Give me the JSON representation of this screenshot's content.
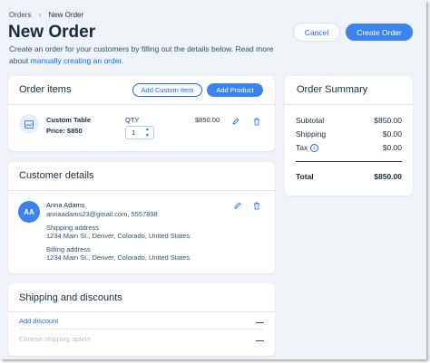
{
  "breadcrumb": {
    "parent": "Orders",
    "current": "New Order"
  },
  "page": {
    "title": "New Order",
    "subtitle_text": "Create an order for your customers by filling out the details below. Read more about",
    "subtitle_link": "manually creating an order",
    "subtitle_end": "."
  },
  "header_actions": {
    "cancel": "Cancel",
    "create": "Create Order"
  },
  "order_items": {
    "title": "Order items",
    "add_custom_item": "Add Custom Item",
    "add_product": "Add Product",
    "item": {
      "name": "Custom Table",
      "price_label": "Price: $850",
      "qty_label": "QTY",
      "qty_value": "1",
      "total": "$850.00"
    }
  },
  "customer": {
    "title": "Customer details",
    "initials": "AA",
    "name": "Anna Adams",
    "contact": "annaadams23@gmail.com, 5557898",
    "shipping_label": "Shipping address",
    "shipping_value": "1234 Main St., Denver, Colorado, United States",
    "billing_label": "Billing address",
    "billing_value": "1234 Main St., Denver, Colorado, United States"
  },
  "shipping": {
    "title": "Shipping and discounts",
    "add_discount": "Add discount",
    "shipping_option": "Choose shipping option"
  },
  "summary": {
    "title": "Order Summary",
    "subtotal_label": "Subtotal",
    "subtotal_value": "$850.00",
    "shipping_label": "Shipping",
    "shipping_value": "$0.00",
    "tax_label": "Tax",
    "tax_value": "$0.00",
    "total_label": "Total",
    "total_value": "$850.00"
  },
  "colors": {
    "accent": "#116dff",
    "background": "#eff3f8",
    "text": "#162d3d",
    "avatar": "#3b84f0"
  },
  "icons": [
    "chevron-right-icon",
    "image-placeholder-icon",
    "edit-icon",
    "trash-icon",
    "info-icon",
    "stepper-up-icon",
    "stepper-down-icon"
  ]
}
